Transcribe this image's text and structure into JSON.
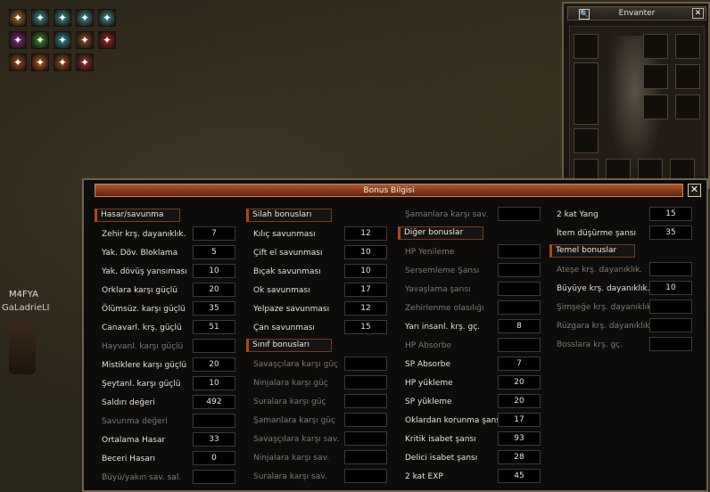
{
  "character": {
    "name": "M4FYA",
    "guild": "GaLadrieLI"
  },
  "buffs": [
    {
      "icon": "sun-emblem-icon",
      "color": "#a06a2c"
    },
    {
      "icon": "frost-rune-icon",
      "color": "#3a8a8c"
    },
    {
      "icon": "frost-rune-icon",
      "color": "#3a8a8c"
    },
    {
      "icon": "frost-rune-icon",
      "color": "#3a8a8c"
    },
    {
      "icon": "frost-rune-icon",
      "color": "#3a8a8c"
    },
    {
      "icon": "purple-orb-icon",
      "color": "#7a2a8c"
    },
    {
      "icon": "green-orb-icon",
      "color": "#3a8a2c"
    },
    {
      "icon": "cyan-claw-icon",
      "color": "#2a8aa0"
    },
    {
      "icon": "axe-rune-icon",
      "color": "#8a4a2a"
    },
    {
      "icon": "red-shield-icon",
      "color": "#a02020"
    },
    {
      "icon": "flame-rune-icon",
      "color": "#9a4a20"
    },
    {
      "icon": "burst-rune-icon",
      "color": "#b05a20"
    },
    {
      "icon": "torch-rune-icon",
      "color": "#9a4a20"
    },
    {
      "icon": "spiral-rune-icon",
      "color": "#903020"
    }
  ],
  "inventory": {
    "title": "Envanter",
    "close": "✕",
    "search": "🔍"
  },
  "bonus_window": {
    "title": "Bonus Bilgisi",
    "close": "✕",
    "col1": {
      "header": "Hasar/savunma",
      "rows": [
        {
          "label": "Zehir krş. dayanıklık.",
          "value": "7",
          "dim": false
        },
        {
          "label": "Yak. Döv. Bloklama",
          "value": "5",
          "dim": false
        },
        {
          "label": "Yak. dövüş yansıması",
          "value": "10",
          "dim": false
        },
        {
          "label": "Orklara karşı güçlü",
          "value": "20",
          "dim": false
        },
        {
          "label": "Ölümsüz. karşı güçlü",
          "value": "35",
          "dim": false
        },
        {
          "label": "Canavarl. krş. güçlü",
          "value": "51",
          "dim": false
        },
        {
          "label": "Hayvanl. karşı güçlü",
          "value": "",
          "dim": true
        },
        {
          "label": "Mistiklere karşı güçlü",
          "value": "20",
          "dim": false
        },
        {
          "label": "Şeytanl. karşı güçlü",
          "value": "10",
          "dim": false
        },
        {
          "label": "Saldırı değeri",
          "value": "492",
          "dim": false
        },
        {
          "label": "Savunma değeri",
          "value": "",
          "dim": true
        },
        {
          "label": "Ortalama Hasar",
          "value": "33",
          "dim": false
        },
        {
          "label": "Beceri Hasarı",
          "value": "0",
          "dim": false
        },
        {
          "label": "Büyü/yakın sav. sal.",
          "value": "",
          "dim": true
        }
      ]
    },
    "col2": {
      "header": "Silah bonusları",
      "rows": [
        {
          "label": "Kılıç savunması",
          "value": "12",
          "dim": false
        },
        {
          "label": "Çift el savunması",
          "value": "10",
          "dim": false
        },
        {
          "label": "Bıçak savunması",
          "value": "10",
          "dim": false
        },
        {
          "label": "Ok savunması",
          "value": "17",
          "dim": false
        },
        {
          "label": "Yelpaze savunması",
          "value": "12",
          "dim": false
        },
        {
          "label": "Çan savunması",
          "value": "15",
          "dim": false
        }
      ],
      "header2": "Sınıf bonusları",
      "rows2": [
        {
          "label": "Savaşçılara karşı güç",
          "value": "",
          "dim": true
        },
        {
          "label": "Ninjalara karşı güç",
          "value": "",
          "dim": true
        },
        {
          "label": "Suralara karşı güç",
          "value": "",
          "dim": true
        },
        {
          "label": "Şamanlara karşı güç",
          "value": "",
          "dim": true
        },
        {
          "label": "Savaşçılara karşı sav.",
          "value": "",
          "dim": true
        },
        {
          "label": "Ninjalara karşı sav.",
          "value": "",
          "dim": true
        },
        {
          "label": "Suralara karşı sav.",
          "value": "",
          "dim": true
        }
      ]
    },
    "col3": {
      "top_row": {
        "label": "Şamanlara karşı sav.",
        "value": "",
        "dim": true
      },
      "header": "Diğer bonuslar",
      "rows": [
        {
          "label": "HP Yenileme",
          "value": "",
          "dim": true
        },
        {
          "label": "Sersemleme Şansı",
          "value": "",
          "dim": true
        },
        {
          "label": "Yavaşlama şansı",
          "value": "",
          "dim": true
        },
        {
          "label": "Zehirlenme olasılığı",
          "value": "",
          "dim": true
        },
        {
          "label": "Yarı insanl. krş. gç.",
          "value": "8",
          "dim": false
        },
        {
          "label": "HP Absorbe",
          "value": "",
          "dim": true
        },
        {
          "label": "SP Absorbe",
          "value": "7",
          "dim": false
        },
        {
          "label": "HP yükleme",
          "value": "20",
          "dim": false
        },
        {
          "label": "SP yükleme",
          "value": "20",
          "dim": false
        },
        {
          "label": "Oklardan korunma şans",
          "value": "17",
          "dim": false
        },
        {
          "label": "Kritik isabet şansı",
          "value": "93",
          "dim": false
        },
        {
          "label": "Delici isabet şansı",
          "value": "28",
          "dim": false
        },
        {
          "label": "2 kat EXP",
          "value": "45",
          "dim": false
        }
      ]
    },
    "col4": {
      "top_rows": [
        {
          "label": "2 kat Yang",
          "value": "15",
          "dim": false
        },
        {
          "label": "İtem düşürme şansı",
          "value": "35",
          "dim": false
        }
      ],
      "header": "Temel bonuslar",
      "rows": [
        {
          "label": "Ateşe krş. dayanıklık.",
          "value": "",
          "dim": true
        },
        {
          "label": "Büyüye krş. dayanıklık.",
          "value": "10",
          "dim": false
        },
        {
          "label": "Şimşeğe krş. dayanıklık.",
          "value": "",
          "dim": true
        },
        {
          "label": "Rüzgara krş. dayanıklık.",
          "value": "",
          "dim": true
        },
        {
          "label": "Bosslara krş. gç.",
          "value": "",
          "dim": true
        }
      ]
    }
  }
}
